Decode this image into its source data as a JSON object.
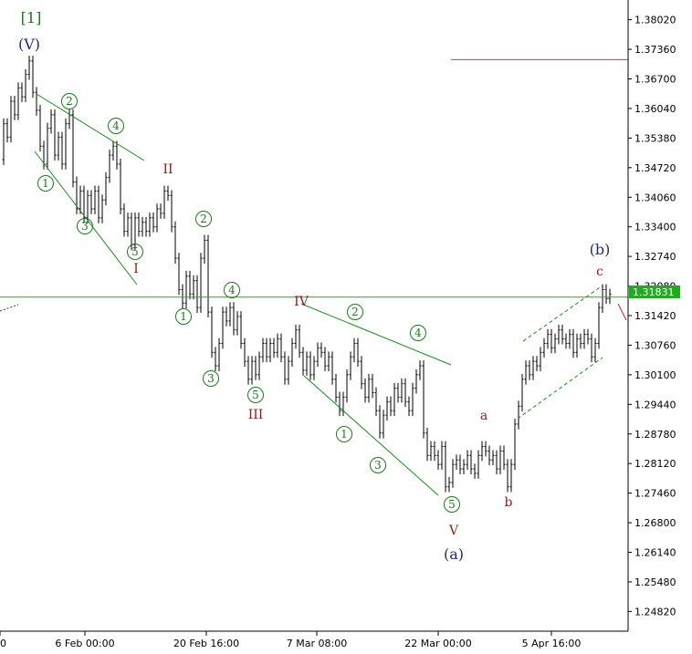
{
  "chart_data": {
    "type": "candlestick",
    "price_tag": "1.31831",
    "current_price": 1.31831,
    "resistance_level": 1.3713,
    "ylim": [
      1.2438,
      1.3846
    ],
    "y_ticks": [
      "1.38020",
      "1.37360",
      "1.36700",
      "1.36040",
      "1.35380",
      "1.34720",
      "1.34060",
      "1.33400",
      "1.32740",
      "1.32080",
      "1.31420",
      "1.30760",
      "1.30100",
      "1.29440",
      "1.28780",
      "1.28120",
      "1.27460",
      "1.26800",
      "1.26140",
      "1.25480",
      "1.24820"
    ],
    "x_ticks": [
      "0",
      "6 Feb 00:00",
      "20 Feb 16:00",
      "7 Mar 08:00",
      "22 Mar 00:00",
      "5 Apr 16:00"
    ],
    "series": [
      {
        "values": [
          [
            0,
            1.349
          ],
          [
            4,
            1.357
          ],
          [
            8,
            1.354
          ],
          [
            12,
            1.362
          ],
          [
            16,
            1.359
          ],
          [
            20,
            1.365
          ],
          [
            24,
            1.363
          ],
          [
            28,
            1.368
          ],
          [
            32,
            1.371
          ],
          [
            36,
            1.364
          ],
          [
            40,
            1.36
          ],
          [
            44,
            1.352
          ],
          [
            48,
            1.348
          ],
          [
            52,
            1.356
          ],
          [
            56,
            1.359
          ],
          [
            60,
            1.35
          ],
          [
            64,
            1.354
          ],
          [
            68,
            1.348
          ],
          [
            72,
            1.357
          ],
          [
            76,
            1.359
          ],
          [
            80,
            1.344
          ],
          [
            84,
            1.338
          ],
          [
            88,
            1.342
          ],
          [
            92,
            1.336
          ],
          [
            96,
            1.341
          ],
          [
            100,
            1.338
          ],
          [
            104,
            1.342
          ],
          [
            108,
            1.336
          ],
          [
            112,
            1.34
          ],
          [
            116,
            1.345
          ],
          [
            120,
            1.35
          ],
          [
            124,
            1.352
          ],
          [
            128,
            1.348
          ],
          [
            132,
            1.338
          ],
          [
            136,
            1.333
          ],
          [
            140,
            1.336
          ],
          [
            144,
            1.33
          ],
          [
            148,
            1.336
          ],
          [
            152,
            1.333
          ],
          [
            156,
            1.335
          ],
          [
            160,
            1.333
          ],
          [
            164,
            1.336
          ],
          [
            168,
            1.334
          ],
          [
            172,
            1.338
          ],
          [
            176,
            1.337
          ],
          [
            180,
            1.342
          ],
          [
            184,
            1.341
          ],
          [
            188,
            1.334
          ],
          [
            192,
            1.327
          ],
          [
            196,
            1.32
          ],
          [
            200,
            1.317
          ],
          [
            204,
            1.323
          ],
          [
            208,
            1.319
          ],
          [
            212,
            1.322
          ],
          [
            216,
            1.316
          ],
          [
            220,
            1.327
          ],
          [
            224,
            1.331
          ],
          [
            228,
            1.315
          ],
          [
            232,
            1.306
          ],
          [
            236,
            1.303
          ],
          [
            240,
            1.308
          ],
          [
            244,
            1.315
          ],
          [
            248,
            1.313
          ],
          [
            252,
            1.316
          ],
          [
            256,
            1.311
          ],
          [
            260,
            1.314
          ],
          [
            264,
            1.308
          ],
          [
            268,
            1.304
          ],
          [
            272,
            1.3
          ],
          [
            276,
            1.304
          ],
          [
            280,
            1.301
          ],
          [
            284,
            1.305
          ],
          [
            288,
            1.308
          ],
          [
            292,
            1.305
          ],
          [
            296,
            1.308
          ],
          [
            300,
            1.306
          ],
          [
            304,
            1.309
          ],
          [
            308,
            1.305
          ],
          [
            312,
            1.3
          ],
          [
            316,
            1.304
          ],
          [
            320,
            1.308
          ],
          [
            324,
            1.311
          ],
          [
            328,
            1.306
          ],
          [
            332,
            1.302
          ],
          [
            336,
            1.305
          ],
          [
            340,
            1.301
          ],
          [
            344,
            1.304
          ],
          [
            348,
            1.307
          ],
          [
            352,
            1.306
          ],
          [
            356,
            1.303
          ],
          [
            360,
            1.305
          ],
          [
            364,
            1.3
          ],
          [
            368,
            1.296
          ],
          [
            372,
            1.293
          ],
          [
            376,
            1.296
          ],
          [
            380,
            1.301
          ],
          [
            384,
            1.305
          ],
          [
            388,
            1.308
          ],
          [
            392,
            1.304
          ],
          [
            396,
            1.299
          ],
          [
            400,
            1.296
          ],
          [
            404,
            1.3
          ],
          [
            408,
            1.297
          ],
          [
            412,
            1.293
          ],
          [
            416,
            1.288
          ],
          [
            420,
            1.292
          ],
          [
            424,
            1.295
          ],
          [
            428,
            1.293
          ],
          [
            432,
            1.298
          ],
          [
            436,
            1.296
          ],
          [
            440,
            1.299
          ],
          [
            444,
            1.295
          ],
          [
            448,
            1.293
          ],
          [
            452,
            1.298
          ],
          [
            456,
            1.301
          ],
          [
            460,
            1.303
          ],
          [
            464,
            1.288
          ],
          [
            468,
            1.283
          ],
          [
            472,
            1.285
          ],
          [
            476,
            1.283
          ],
          [
            480,
            1.281
          ],
          [
            484,
            1.285
          ],
          [
            488,
            1.276
          ],
          [
            492,
            1.277
          ],
          [
            496,
            1.281
          ],
          [
            500,
            1.282
          ],
          [
            504,
            1.28
          ],
          [
            508,
            1.281
          ],
          [
            512,
            1.283
          ],
          [
            516,
            1.28
          ],
          [
            520,
            1.279
          ],
          [
            524,
            1.283
          ],
          [
            528,
            1.285
          ],
          [
            532,
            1.284
          ],
          [
            536,
            1.282
          ],
          [
            540,
            1.283
          ],
          [
            544,
            1.28
          ],
          [
            548,
            1.284
          ],
          [
            552,
            1.281
          ],
          [
            556,
            1.276
          ],
          [
            560,
            1.281
          ],
          [
            564,
            1.29
          ],
          [
            568,
            1.294
          ],
          [
            572,
            1.3
          ],
          [
            576,
            1.303
          ],
          [
            580,
            1.301
          ],
          [
            584,
            1.304
          ],
          [
            588,
            1.303
          ],
          [
            592,
            1.306
          ],
          [
            596,
            1.308
          ],
          [
            600,
            1.31
          ],
          [
            604,
            1.307
          ],
          [
            608,
            1.309
          ],
          [
            612,
            1.311
          ],
          [
            616,
            1.309
          ],
          [
            620,
            1.308
          ],
          [
            624,
            1.31
          ],
          [
            628,
            1.306
          ],
          [
            632,
            1.309
          ],
          [
            636,
            1.308
          ],
          [
            640,
            1.31
          ],
          [
            644,
            1.309
          ],
          [
            648,
            1.305
          ],
          [
            652,
            1.308
          ],
          [
            656,
            1.316
          ],
          [
            660,
            1.32
          ],
          [
            664,
            1.318
          ],
          [
            668,
            1.319
          ]
        ]
      }
    ],
    "wave_labels": {
      "degree1": "[1]",
      "V_top": "(V)",
      "a_paren": "(a)",
      "b_paren": "(b)",
      "I": "I",
      "II": "II",
      "III": "III",
      "IV": "IV",
      "V": "V",
      "a": "a",
      "b": "b",
      "c": "c",
      "n1": "1",
      "n2": "2",
      "n3": "3",
      "n4": "4",
      "n5": "5"
    },
    "colors": {
      "candle": "#000000",
      "trendline": "#1a8a1a",
      "horizontal_level": "#22aa22",
      "resistance": "#cc22cc",
      "price_tag_bg": "#22aa22",
      "wave_green": "#1a7a1a",
      "wave_red": "#8b1a1a",
      "wave_blue": "#1f2a7a"
    }
  }
}
